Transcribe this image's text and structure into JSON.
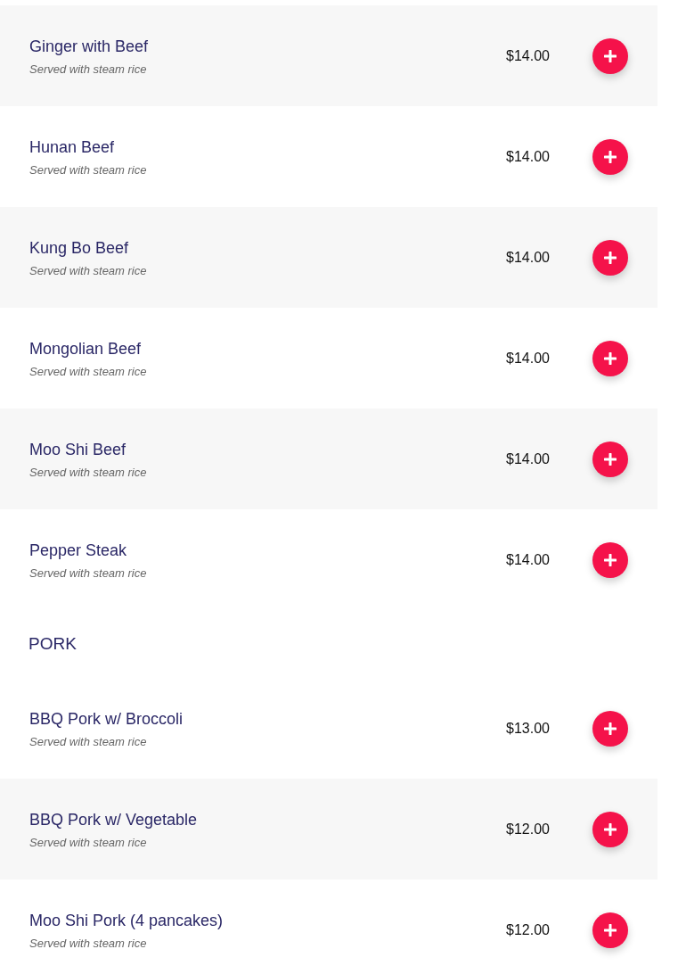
{
  "sections": [
    {
      "items": [
        {
          "name": "Ginger with Beef",
          "description": "Served with steam rice",
          "price": "$14.00"
        },
        {
          "name": "Hunan Beef",
          "description": "Served with steam rice",
          "price": "$14.00"
        },
        {
          "name": "Kung Bo Beef",
          "description": "Served with steam rice",
          "price": "$14.00"
        },
        {
          "name": "Mongolian Beef",
          "description": "Served with steam rice",
          "price": "$14.00"
        },
        {
          "name": "Moo Shi Beef",
          "description": "Served with steam rice",
          "price": "$14.00"
        },
        {
          "name": "Pepper Steak",
          "description": "Served with steam rice",
          "price": "$14.00"
        }
      ]
    },
    {
      "title": "PORK",
      "items": [
        {
          "name": "BBQ Pork w/ Broccoli",
          "description": "Served with steam rice",
          "price": "$13.00"
        },
        {
          "name": "BBQ Pork w/ Vegetable",
          "description": "Served with steam rice",
          "price": "$12.00"
        },
        {
          "name": "Moo Shi Pork (4 pancakes)",
          "description": "Served with steam rice",
          "price": "$12.00"
        }
      ]
    }
  ]
}
